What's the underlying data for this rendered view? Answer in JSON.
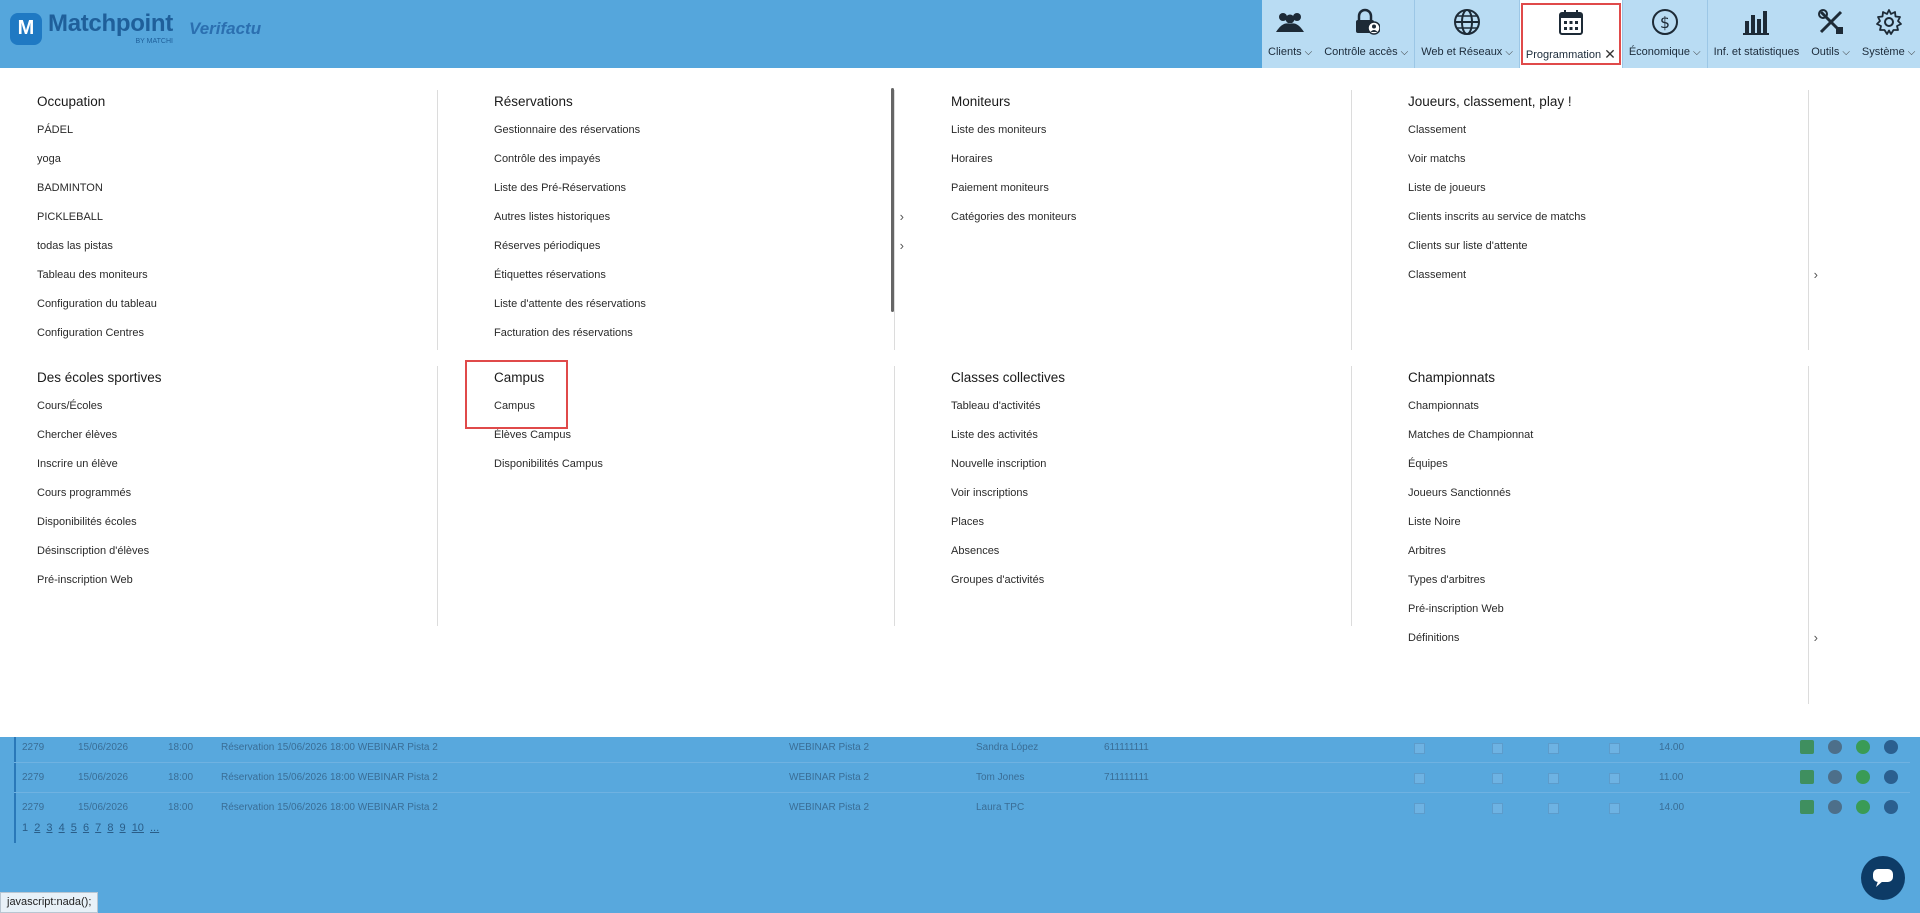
{
  "brand": {
    "name": "Matchpoint",
    "sub": "BY MATCHI",
    "badge": "M",
    "partner": "Verifactu"
  },
  "nav": [
    {
      "key": "clients",
      "label": "Clients",
      "icon": "users-icon",
      "chevron": true
    },
    {
      "key": "controle",
      "label": "Contrôle accès",
      "icon": "lock-user-icon",
      "chevron": true
    },
    {
      "key": "web",
      "label": "Web et Réseaux",
      "icon": "globe-icon",
      "chevron": true
    },
    {
      "key": "programmation",
      "label": "Programmation",
      "icon": "calendar-icon",
      "active": true
    },
    {
      "key": "economique",
      "label": "Économique",
      "icon": "dollar-icon",
      "chevron": true
    },
    {
      "key": "stats",
      "label": "Inf. et statistiques",
      "icon": "bar-chart-icon"
    },
    {
      "key": "outils",
      "label": "Outils",
      "icon": "tools-icon",
      "chevron": true
    },
    {
      "key": "systeme",
      "label": "Système",
      "icon": "gear-icon",
      "chevron": true
    }
  ],
  "sections": [
    {
      "title": "Occupation",
      "items": [
        "PÁDEL",
        "yoga",
        "BADMINTON",
        "PICKLEBALL",
        "todas las pistas",
        "Tableau des moniteurs",
        "Configuration du tableau",
        "Configuration Centres"
      ]
    },
    {
      "title": "Réservations",
      "items": [
        "Gestionnaire des réservations",
        "Contrôle des impayés",
        "Liste des Pré-Réservations",
        "Autres listes historiques",
        "Réserves périodiques",
        "Étiquettes réservations",
        "Liste d'attente des réservations",
        "Facturation des réservations"
      ],
      "arrows": [
        3,
        4
      ]
    },
    {
      "title": "Moniteurs",
      "items": [
        "Liste des moniteurs",
        "Horaires",
        "Paiement moniteurs",
        "Catégories des moniteurs"
      ]
    },
    {
      "title": "Joueurs, classement, play !",
      "items": [
        "Classement",
        "Voir matchs",
        "Liste de joueurs",
        "Clients inscrits au service de matchs",
        "Clients sur liste d'attente",
        "Classement"
      ],
      "arrows": [
        5
      ]
    },
    {
      "title": "Des écoles sportives",
      "items": [
        "Cours/Écoles",
        "Chercher élèves",
        "Inscrire un élève",
        "Cours programmés",
        "Disponibilités écoles",
        "Désinscription d'élèves",
        "Pré-inscription Web"
      ]
    },
    {
      "title": "Campus",
      "items": [
        "Campus",
        "Élèves Campus",
        "Disponibilités Campus"
      ]
    },
    {
      "title": "Classes collectives",
      "items": [
        "Tableau d'activités",
        "Liste des activités",
        "Nouvelle inscription",
        "Voir inscriptions",
        "Places",
        "Absences",
        "Groupes d'activités"
      ]
    },
    {
      "title": "Championnats",
      "items": [
        "Championnats",
        "Matches de Championnat",
        "Équipes",
        "Joueurs Sanctionnés",
        "Liste Noire",
        "Arbitres",
        "Types d'arbitres",
        "Pré-inscription Web",
        "Définitions"
      ],
      "arrows": [
        8
      ]
    }
  ],
  "bg_rows": [
    {
      "id": "2279",
      "date": "15/06/2026",
      "time": "18:00",
      "desc": "Réservation 15/06/2026 18:00 WEBINAR Pista 2",
      "court": "WEBINAR Pista 2",
      "name": "Sandra López",
      "phone": "611111111",
      "amount": "14.00"
    },
    {
      "id": "2279",
      "date": "15/06/2026",
      "time": "18:00",
      "desc": "Réservation 15/06/2026 18:00 WEBINAR Pista 2",
      "court": "WEBINAR Pista 2",
      "name": "Tom Jones",
      "phone": "711111111",
      "amount": "11.00"
    },
    {
      "id": "2279",
      "date": "15/06/2026",
      "time": "18:00",
      "desc": "Réservation 15/06/2026 18:00 WEBINAR Pista 2",
      "court": "WEBINAR Pista 2",
      "name": "Laura TPC",
      "phone": "",
      "amount": "14.00"
    }
  ],
  "pager": {
    "current": "1",
    "pages": [
      "2",
      "3",
      "4",
      "5",
      "6",
      "7",
      "8",
      "9",
      "10",
      "..."
    ]
  },
  "status_text": "javascript:nada();"
}
